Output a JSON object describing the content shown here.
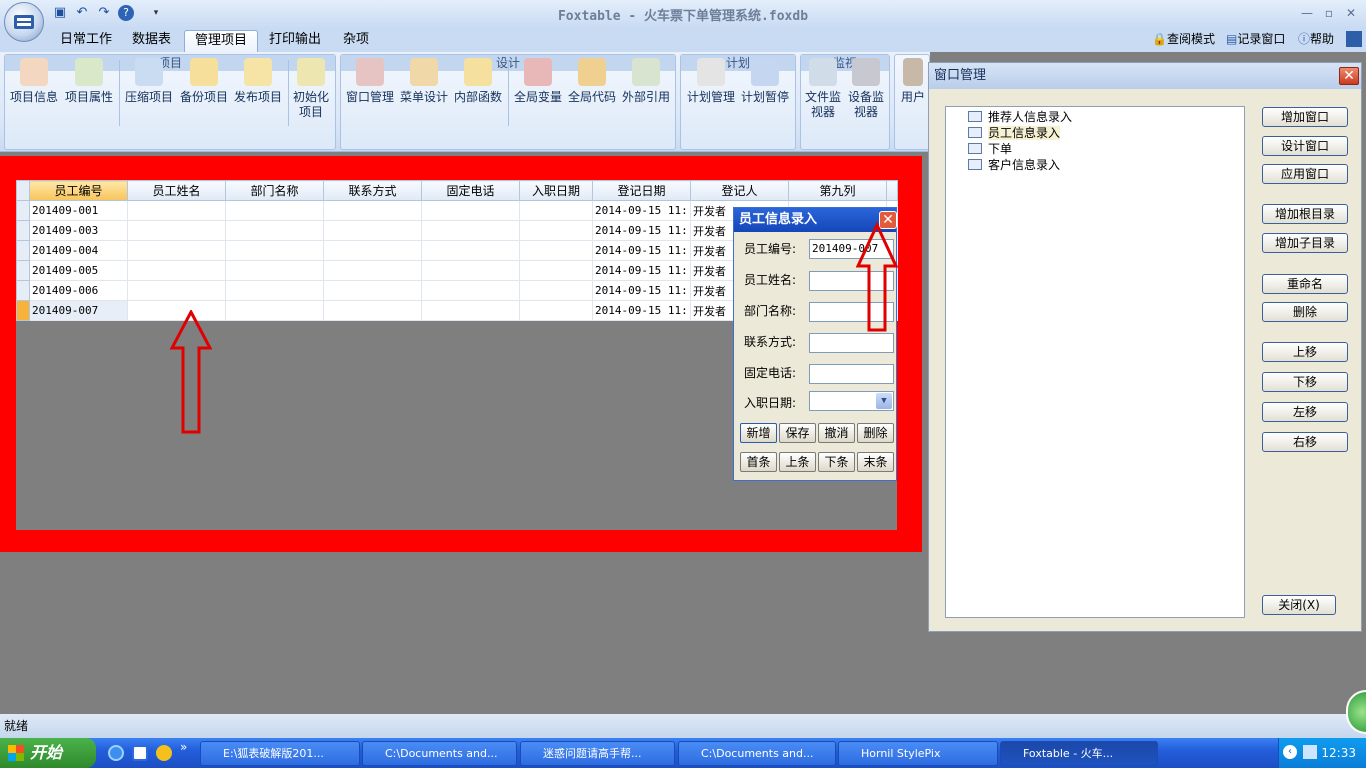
{
  "window": {
    "title": "Foxtable - 火车票下单管理系统.foxdb"
  },
  "ribbon_tabs": [
    "日常工作",
    "数据表",
    "管理项目",
    "打印输出",
    "杂项"
  ],
  "active_tab": "管理项目",
  "right_tools": {
    "read_mode": "查阅模式",
    "record_window": "记录窗口",
    "help": "帮助"
  },
  "groups": {
    "project": {
      "label": "项目",
      "buttons": [
        "项目信息",
        "项目属性",
        "压缩项目",
        "备份项目",
        "发布项目",
        "初始化项目"
      ]
    },
    "design": {
      "label": "设计",
      "buttons": [
        "窗口管理",
        "菜单设计",
        "内部函数",
        "全局变量",
        "全局代码",
        "外部引用"
      ]
    },
    "plan": {
      "label": "计划",
      "buttons": [
        "计划管理",
        "计划暂停"
      ]
    },
    "monitor": {
      "label": "监视",
      "buttons": [
        "文件监视器",
        "设备监视器"
      ]
    },
    "user": {
      "buttons": [
        "用户"
      ]
    }
  },
  "grid": {
    "columns": [
      "员工编号",
      "员工姓名",
      "部门名称",
      "联系方式",
      "固定电话",
      "入职日期",
      "登记日期",
      "登记人",
      "第九列"
    ],
    "rows": [
      [
        "201409-001",
        "",
        "",
        "",
        "",
        "",
        "2014-09-15 11:",
        "开发者",
        ""
      ],
      [
        "201409-003",
        "",
        "",
        "",
        "",
        "",
        "2014-09-15 11:",
        "开发者",
        ""
      ],
      [
        "201409-004",
        "",
        "",
        "",
        "",
        "",
        "2014-09-15 11:",
        "开发者",
        ""
      ],
      [
        "201409-005",
        "",
        "",
        "",
        "",
        "",
        "2014-09-15 11:",
        "开发者",
        ""
      ],
      [
        "201409-006",
        "",
        "",
        "",
        "",
        "",
        "2014-09-15 11:",
        "开发者",
        ""
      ],
      [
        "201409-007",
        "",
        "",
        "",
        "",
        "",
        "2014-09-15 11:",
        "开发者",
        ""
      ]
    ]
  },
  "employee_form": {
    "title": "员工信息录入",
    "fields": [
      {
        "label": "员工编号:",
        "value": "201409-007"
      },
      {
        "label": "员工姓名:",
        "value": ""
      },
      {
        "label": "部门名称:",
        "value": ""
      },
      {
        "label": "联系方式:",
        "value": ""
      },
      {
        "label": "固定电话:",
        "value": ""
      },
      {
        "label": "入职日期:",
        "value": ""
      }
    ],
    "buttons_row1": [
      "新增",
      "保存",
      "撤消",
      "删除"
    ],
    "buttons_row2": [
      "首条",
      "上条",
      "下条",
      "末条"
    ]
  },
  "window_manager": {
    "title": "窗口管理",
    "tree": [
      "推荐人信息录入",
      "员工信息录入",
      "下单",
      "客户信息录入"
    ],
    "selected": "员工信息录入",
    "buttons": [
      "增加窗口",
      "设计窗口",
      "应用窗口",
      "增加根目录",
      "增加子目录",
      "重命名",
      "删除",
      "上移",
      "下移",
      "左移",
      "右移"
    ],
    "close_button": "关闭(X)"
  },
  "status": {
    "text": "就绪"
  },
  "taskbar": {
    "start": "开始",
    "items": [
      "E:\\狐表破解版201...",
      "C:\\Documents and...",
      "迷惑问题请高手帮...",
      "C:\\Documents and...",
      "Hornil StylePix",
      "Foxtable - 火车..."
    ],
    "clock": "12:33"
  },
  "colors": {
    "highlight": "#ff0000",
    "titlebar": "#2a66d9"
  }
}
